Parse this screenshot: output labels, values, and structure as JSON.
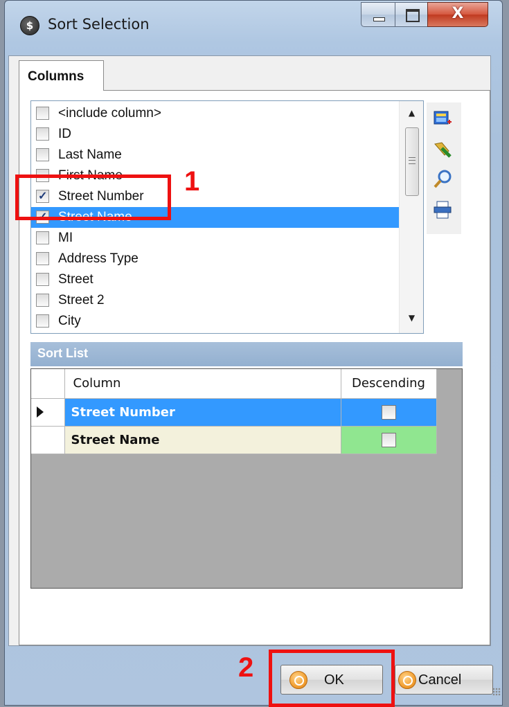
{
  "window": {
    "title": "Sort Selection",
    "close_glyph": "X"
  },
  "tabs": [
    {
      "label": "Columns"
    }
  ],
  "columns_list": {
    "items": [
      {
        "label": "<include column>",
        "checked": false
      },
      {
        "label": "ID",
        "checked": false
      },
      {
        "label": "Last Name",
        "checked": false
      },
      {
        "label": "First Name",
        "checked": false
      },
      {
        "label": "Street Number",
        "checked": true
      },
      {
        "label": "Street Name",
        "checked": true,
        "selected": true
      },
      {
        "label": "MI",
        "checked": false
      },
      {
        "label": "Address Type",
        "checked": false
      },
      {
        "label": "Street",
        "checked": false
      },
      {
        "label": "Street 2",
        "checked": false
      },
      {
        "label": "City",
        "checked": false
      }
    ],
    "toolbar_icons": [
      "add-column-icon",
      "brush-icon",
      "magnifier-icon",
      "printer-icon"
    ]
  },
  "sort_list": {
    "title": "Sort List",
    "headers": {
      "column": "Column",
      "descending": "Descending"
    },
    "rows": [
      {
        "column": "Street Number",
        "descending": false,
        "current": true
      },
      {
        "column": "Street Name",
        "descending": false,
        "current": false
      }
    ]
  },
  "buttons": {
    "ok": "OK",
    "cancel": "Cancel"
  },
  "annotations": {
    "step1": "1",
    "step2": "2",
    "color": "#ee1111"
  }
}
